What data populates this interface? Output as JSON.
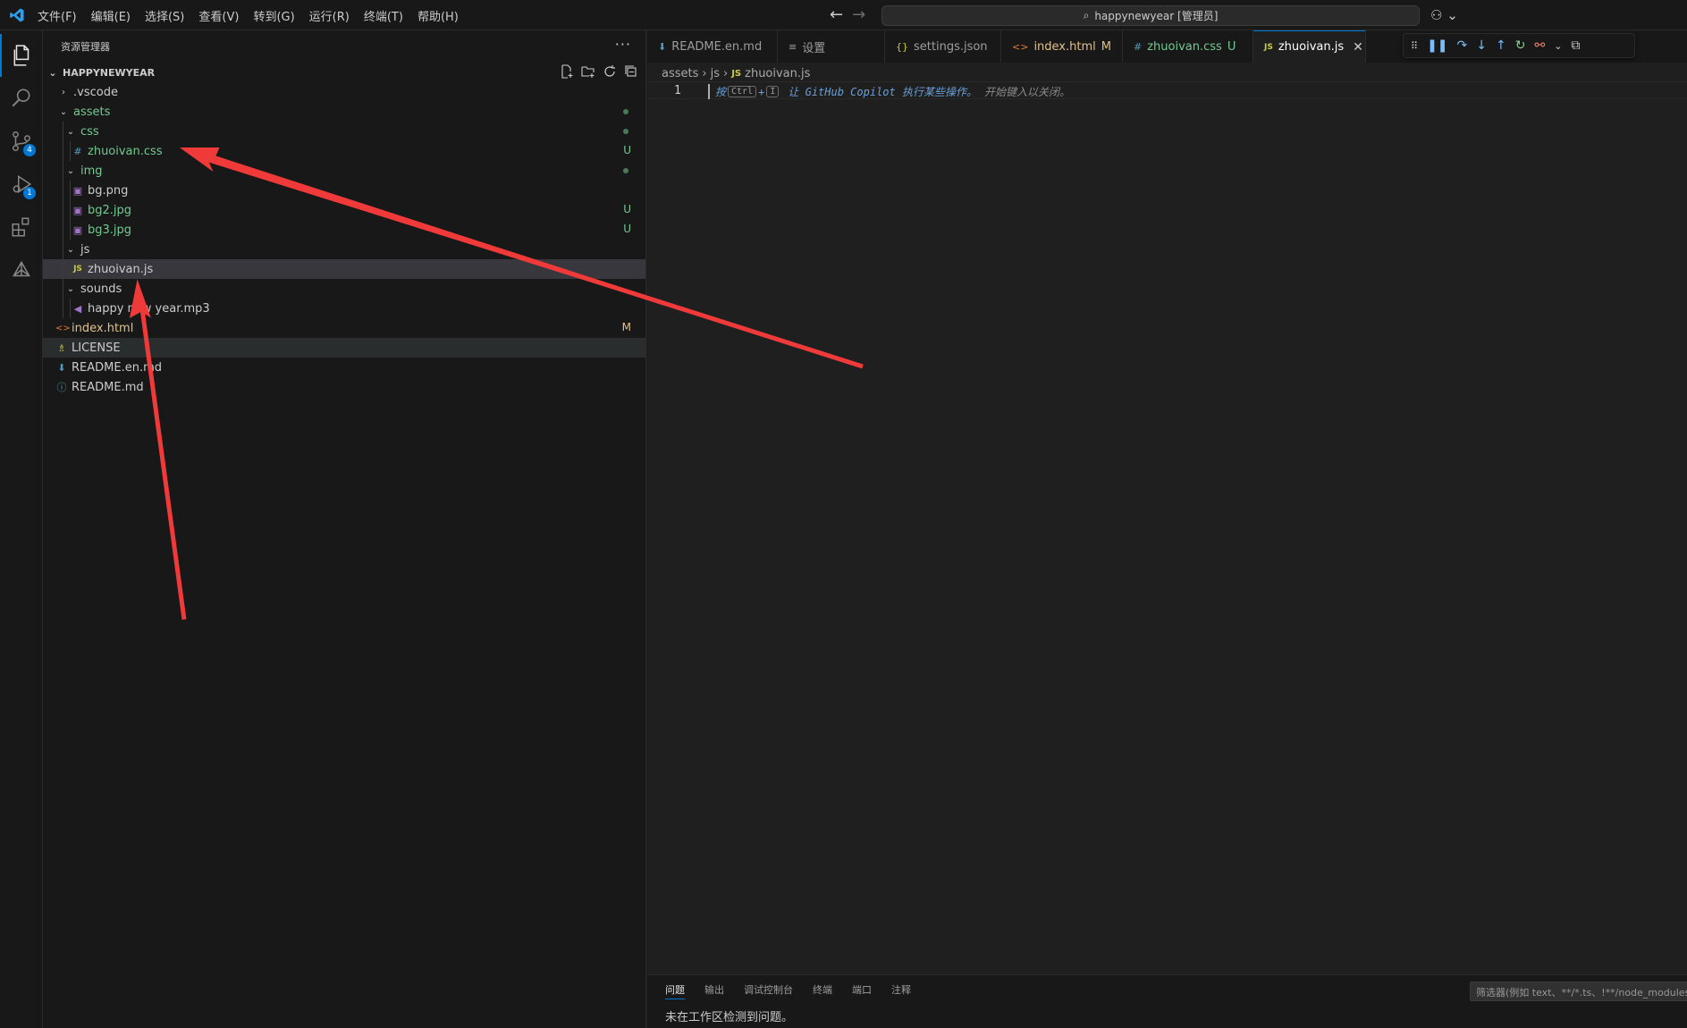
{
  "titlebar": {
    "menu": [
      "文件(F)",
      "编辑(E)",
      "选择(S)",
      "查看(V)",
      "转到(G)",
      "运行(R)",
      "终端(T)",
      "帮助(H)"
    ],
    "search_text": "happynewyear [管理员]"
  },
  "activity_bar": {
    "scm_badge": "4",
    "debug_badge": "1"
  },
  "sidebar": {
    "title": "资源管理器",
    "more": "···",
    "root": "HAPPYNEWYEAR",
    "items": [
      {
        "label": ".vscode",
        "status": ""
      },
      {
        "label": "assets",
        "status": ""
      },
      {
        "label": "css",
        "status": ""
      },
      {
        "label": "zhuoivan.css",
        "status": "U",
        "icon": "#"
      },
      {
        "label": "img",
        "status": ""
      },
      {
        "label": "bg.png",
        "status": ""
      },
      {
        "label": "bg2.jpg",
        "status": "U"
      },
      {
        "label": "bg3.jpg",
        "status": "U"
      },
      {
        "label": "js",
        "status": ""
      },
      {
        "label": "zhuoivan.js",
        "status": "",
        "icon": "JS"
      },
      {
        "label": "sounds",
        "status": ""
      },
      {
        "label": "happy new year.mp3",
        "status": ""
      },
      {
        "label": "index.html",
        "status": "M",
        "icon": "<>"
      },
      {
        "label": "LICENSE",
        "status": ""
      },
      {
        "label": "README.en.md",
        "status": ""
      },
      {
        "label": "README.md",
        "status": "",
        "icon": "ⓘ"
      }
    ]
  },
  "tabs": [
    {
      "label": "README.en.md",
      "icon": "⬇",
      "status": ""
    },
    {
      "label": "设置",
      "icon": "≡",
      "status": ""
    },
    {
      "label": "settings.json",
      "icon": "{}",
      "status": ""
    },
    {
      "label": "index.html",
      "icon": "<>",
      "status": "M"
    },
    {
      "label": "zhuoivan.css",
      "icon": "#",
      "status": "U"
    },
    {
      "label": "zhuoivan.js",
      "icon": "JS",
      "status": ""
    }
  ],
  "breadcrumbs": [
    "assets",
    "js",
    "zhuoivan.js"
  ],
  "editor": {
    "line_number": "1",
    "hint_prefix": "按",
    "hint_key1": "Ctrl",
    "hint_plus": "+",
    "hint_key2": "I",
    "hint_main": "让 GitHub Copilot 执行某些操作。",
    "hint_dismiss": "开始键入以关闭。"
  },
  "panel": {
    "tabs": [
      "问题",
      "输出",
      "调试控制台",
      "终端",
      "端口",
      "注释"
    ],
    "filter_placeholder": "筛选器(例如 text、**/*.ts、!**/node_modules/**)",
    "message": "未在工作区检测到问题。"
  },
  "colors": {
    "accent": "#0078d4",
    "untracked": "#73c991",
    "modified": "#e2c08d",
    "annotation_arrow": "#f03a3a"
  }
}
